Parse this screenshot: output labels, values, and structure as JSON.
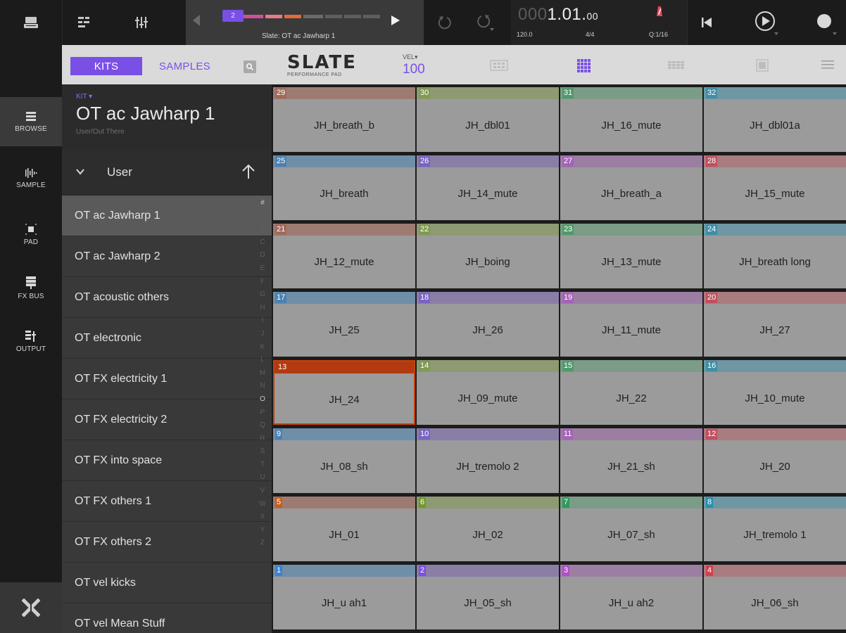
{
  "topbar": {
    "sequence_number": "2",
    "sequence_name": "Slate: OT ac Jawharp 1",
    "counter_dim": "000",
    "counter_main": "1.01.",
    "counter_small": "00",
    "tempo": "120.0",
    "time_signature": "4/4",
    "quantize": "Q:1/16",
    "icons": [
      "menu-icon",
      "track-list-icon",
      "mixer-icon",
      "back-arrow-icon",
      "play-icon",
      "undo-icon",
      "redo-icon",
      "metronome-icon",
      "return-to-start-icon",
      "play-circle-icon",
      "record-icon"
    ]
  },
  "nav": {
    "items": [
      {
        "label": "BROWSE",
        "icon": "browse-icon"
      },
      {
        "label": "SAMPLE",
        "icon": "sample-icon"
      },
      {
        "label": "PAD",
        "icon": "pad-icon"
      },
      {
        "label": "FX BUS",
        "icon": "fx-bus-icon"
      },
      {
        "label": "OUTPUT",
        "icon": "output-icon"
      }
    ]
  },
  "browser": {
    "tab_kits": "KITS",
    "tab_samples": "SAMPLES",
    "kit_label": "KIT",
    "kit_name": "OT ac Jawharp 1",
    "kit_path": "User/Out There",
    "folder_name": "User",
    "list": [
      "OT ac Jawharp 1",
      "OT ac Jawharp 2",
      "OT acoustic others",
      "OT electronic",
      "OT FX electricity 1",
      "OT FX electricity 2",
      "OT FX into space",
      "OT FX others 1",
      "OT FX others 2",
      "OT vel kicks",
      "OT vel Mean Stuff"
    ],
    "alphabet": [
      "#",
      "A",
      "B",
      "C",
      "D",
      "E",
      "F",
      "G",
      "H",
      "I",
      "J",
      "K",
      "L",
      "M",
      "N",
      "O",
      "P",
      "Q",
      "R",
      "S",
      "T",
      "U",
      "V",
      "W",
      "X",
      "Y",
      "Z"
    ]
  },
  "padheader": {
    "logo": "SLATE",
    "logo_sub": "PERFORMANCE PAD",
    "vel_label": "VEL",
    "vel_value": "100"
  },
  "pads": [
    [
      {
        "n": "29",
        "name": "JH_breath_b",
        "color": "#9e7b72"
      },
      {
        "n": "30",
        "name": "JH_dbl01",
        "color": "#8e9a72"
      },
      {
        "n": "31",
        "name": "JH_16_mute",
        "color": "#7b9c86"
      },
      {
        "n": "32",
        "name": "JH_dbl01a",
        "color": "#6f97a3"
      }
    ],
    [
      {
        "n": "25",
        "name": "JH_breath",
        "color": "#6f8ea8"
      },
      {
        "n": "26",
        "name": "JH_14_mute",
        "color": "#8a7ea7"
      },
      {
        "n": "27",
        "name": "JH_breath_a",
        "color": "#9c7ea3"
      },
      {
        "n": "28",
        "name": "JH_15_mute",
        "color": "#a97c80"
      }
    ],
    [
      {
        "n": "21",
        "name": "JH_12_mute",
        "color": "#9e7b72"
      },
      {
        "n": "22",
        "name": "JH_boing",
        "color": "#8e9a72"
      },
      {
        "n": "23",
        "name": "JH_13_mute",
        "color": "#7b9c86"
      },
      {
        "n": "24",
        "name": "JH_breath long",
        "color": "#6f97a3"
      }
    ],
    [
      {
        "n": "17",
        "name": "JH_25",
        "color": "#6f8ea8"
      },
      {
        "n": "18",
        "name": "JH_26",
        "color": "#8a7ea7"
      },
      {
        "n": "19",
        "name": "JH_11_mute",
        "color": "#9c7ea3"
      },
      {
        "n": "20",
        "name": "JH_27",
        "color": "#a97c80"
      }
    ],
    [
      {
        "n": "13",
        "name": "JH_24",
        "color": "#b33a10",
        "active": true
      },
      {
        "n": "14",
        "name": "JH_09_mute",
        "color": "#8e9a72"
      },
      {
        "n": "15",
        "name": "JH_22",
        "color": "#7b9c86"
      },
      {
        "n": "16",
        "name": "JH_10_mute",
        "color": "#6f97a3"
      }
    ],
    [
      {
        "n": "9",
        "name": "JH_08_sh",
        "color": "#6f8ea8"
      },
      {
        "n": "10",
        "name": "JH_tremolo 2",
        "color": "#8a7ea7"
      },
      {
        "n": "11",
        "name": "JH_21_sh",
        "color": "#9c7ea3"
      },
      {
        "n": "12",
        "name": "JH_20",
        "color": "#a97c80"
      }
    ],
    [
      {
        "n": "5",
        "name": "JH_01",
        "color": "#9e7b72"
      },
      {
        "n": "6",
        "name": "JH_02",
        "color": "#8e9a72"
      },
      {
        "n": "7",
        "name": "JH_07_sh",
        "color": "#7b9c86"
      },
      {
        "n": "8",
        "name": "JH_tremolo 1",
        "color": "#6f97a3"
      }
    ],
    [
      {
        "n": "1",
        "name": "JH_u ah1",
        "color": "#6f8ea8"
      },
      {
        "n": "2",
        "name": "JH_05_sh",
        "color": "#8a7ea7"
      },
      {
        "n": "3",
        "name": "JH_u ah2",
        "color": "#9c7ea3"
      },
      {
        "n": "4",
        "name": "JH_06_sh",
        "color": "#a97c80"
      }
    ]
  ],
  "pad_number_colors": {
    "29": "#a06a5c",
    "30": "#7f9a52",
    "31": "#4f9a6a",
    "32": "#3f8fa6",
    "25": "#4a82b0",
    "26": "#7a63c4",
    "27": "#a563b8",
    "28": "#c05060",
    "21": "#a06a5c",
    "22": "#7f9a52",
    "23": "#4f9a6a",
    "24": "#3f8fa6",
    "17": "#4a82b0",
    "18": "#7a63c4",
    "19": "#a563b8",
    "20": "#c05060",
    "13": "#b33a10",
    "14": "#7f9a52",
    "15": "#4f9a6a",
    "16": "#3f8fa6",
    "9": "#4a82b0",
    "10": "#7a63c4",
    "11": "#a563b8",
    "12": "#c05060",
    "5": "#c2601f",
    "6": "#6f9a2a",
    "7": "#2f9a5a",
    "8": "#2a8fb0",
    "1": "#3b82d0",
    "2": "#7a4fe6",
    "3": "#b04fc8",
    "4": "#d04050"
  },
  "colors": {
    "accent": "#7a4fe6",
    "active_pad": "#b33a10"
  }
}
